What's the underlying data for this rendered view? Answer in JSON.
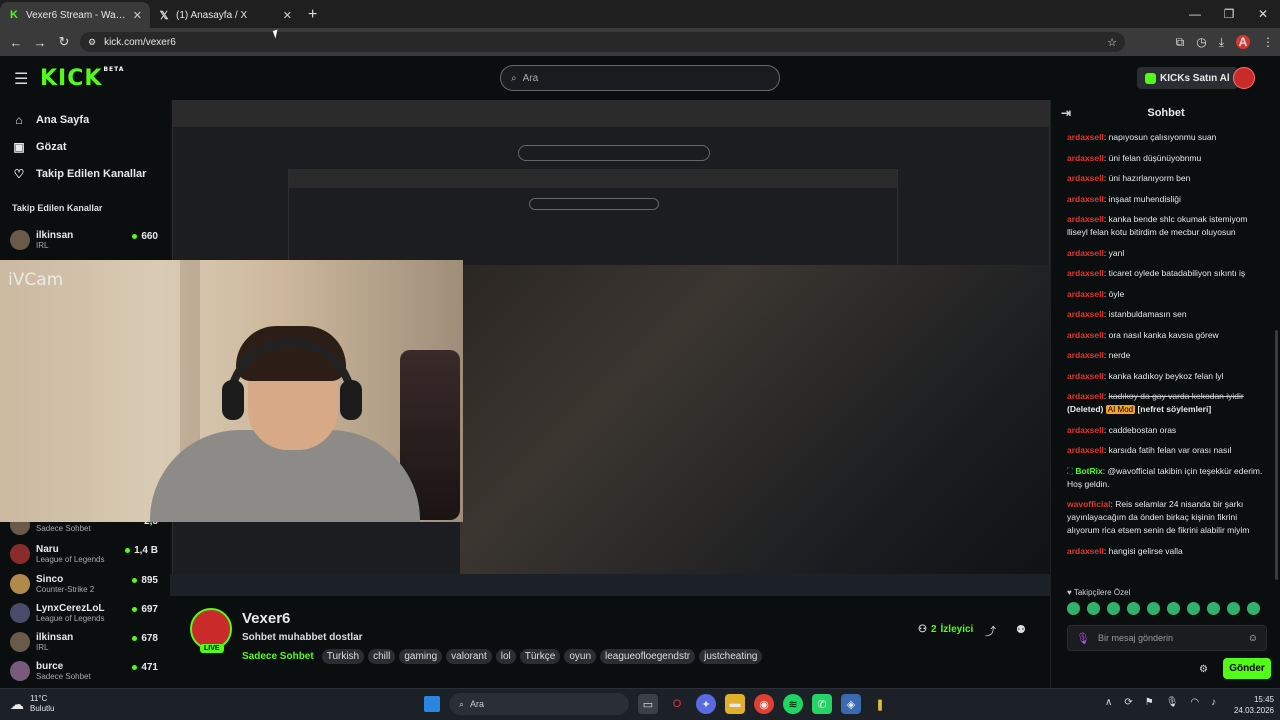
{
  "browser": {
    "tabs": [
      {
        "title": "Vexer6 Stream - Watch Live on Kick",
        "active": true,
        "icon": "kick-icon"
      },
      {
        "title": "(1) Anasayfa / X",
        "active": false,
        "icon": "x-icon"
      }
    ],
    "url": "kick.com/vexer6",
    "profile_initial": "A"
  },
  "header": {
    "logo": "KICK",
    "logo_tag": "BETA",
    "search_placeholder": "Ara",
    "kicks_button": "KICKs Satın Al"
  },
  "sidebar": {
    "nav": [
      {
        "label": "Ana Sayfa",
        "icon": "home-icon"
      },
      {
        "label": "Gözat",
        "icon": "browse-icon"
      },
      {
        "label": "Takip Edilen Kanallar",
        "icon": "heart-icon"
      }
    ],
    "section_title": "Takip Edilen Kanallar",
    "channels": [
      {
        "name": "ilkinsan",
        "category": "IRL",
        "viewers": "660"
      },
      {
        "name": "Naru",
        "category": "League of Legends",
        "viewers": "1,4 B"
      },
      {
        "name": "Sinco",
        "category": "Counter-Strike 2",
        "viewers": "895"
      },
      {
        "name": "LynxCerezLoL",
        "category": "League of Legends",
        "viewers": "697"
      },
      {
        "name": "ilkinsan",
        "category": "IRL",
        "viewers": "678"
      },
      {
        "name": "burce",
        "category": "Sadece Sohbet",
        "viewers": "471"
      }
    ],
    "partial_channel_category": "Sadece Sohbet",
    "partial_channel_viewers": "2,5"
  },
  "webcam": {
    "overlay_label": "iVCam"
  },
  "stream": {
    "name": "Vexer6",
    "live_badge": "LIVE",
    "title": "Sohbet muhabbet dostlar",
    "category": "Sadece Sohbet",
    "tags": [
      "Turkish",
      "chill",
      "gaming",
      "valorant",
      "lol",
      "Türkçe",
      "oyun",
      "leagueofloegendstr",
      "justcheating"
    ],
    "viewers_count": "2",
    "viewers_label": "İzleyici"
  },
  "chat": {
    "title": "Sohbet",
    "messages": [
      {
        "user": "ardaxsell",
        "text": "napıyosun çalısıyonmu suan"
      },
      {
        "user": "ardaxsell",
        "text": "üni felan düşünüyobnmu"
      },
      {
        "user": "ardaxsell",
        "text": "üni hazırlanıyorm ben"
      },
      {
        "user": "ardaxsell",
        "text": "inşaat muhendisliği"
      },
      {
        "user": "ardaxsell",
        "text": "kanka bende shlc okumak istemiyom lliseyl felan kotu bitirdim de mecbur oluyosun"
      },
      {
        "user": "ardaxsell",
        "text": "yanl"
      },
      {
        "user": "ardaxsell",
        "text": "ticaret oylede batadabiliyon sıkıntı iş"
      },
      {
        "user": "ardaxsell",
        "text": "öyle"
      },
      {
        "user": "ardaxsell",
        "text": "istanbuldamasın sen"
      },
      {
        "user": "ardaxsell",
        "text": "ora nasıl kanka kavsıa görew"
      },
      {
        "user": "ardaxsell",
        "text": "nerde"
      },
      {
        "user": "ardaxsell",
        "text": "kanka kadıkoy beykoz felan lyl"
      }
    ],
    "deleted_message": {
      "user": "ardaxsell",
      "text": "kadıkoy da gay varda kekodan iyidir",
      "deleted_label": "(Deleted)",
      "mod_label": "AI Mod",
      "reason": "[nefret söylemleri]"
    },
    "messages_after": [
      {
        "user": "ardaxsell",
        "text": "caddebostan oras"
      },
      {
        "user": "ardaxsell",
        "text": "karsıda fatih felan var orası nasıl"
      }
    ],
    "bot_message": {
      "user": "BotRix",
      "text": "@wavofficial takibin için teşekkür ederim. Hoş geldin."
    },
    "final_messages": [
      {
        "user": "wavofficial",
        "text": "Reis selamlar 24 nisanda bir şarkı yayınlayacağım da önden birkaç kişinin fikrini alıyorum rica etsem senin de fikrini alabilir miyim"
      },
      {
        "user": "ardaxsell",
        "text": "hangisi gelirse valla"
      }
    ],
    "emotes_header": "Takipçilere Özel",
    "input_placeholder": "Bir mesaj gönderin",
    "send_label": "Gönder"
  },
  "taskbar": {
    "weather_temp": "11°C",
    "weather_desc": "Bulutlu",
    "search_label": "Ara",
    "time": "15:45",
    "date": "24.03.2026"
  },
  "colors": {
    "accent": "#53fc18",
    "username": "#e3352f",
    "mod": "#f4a223"
  }
}
